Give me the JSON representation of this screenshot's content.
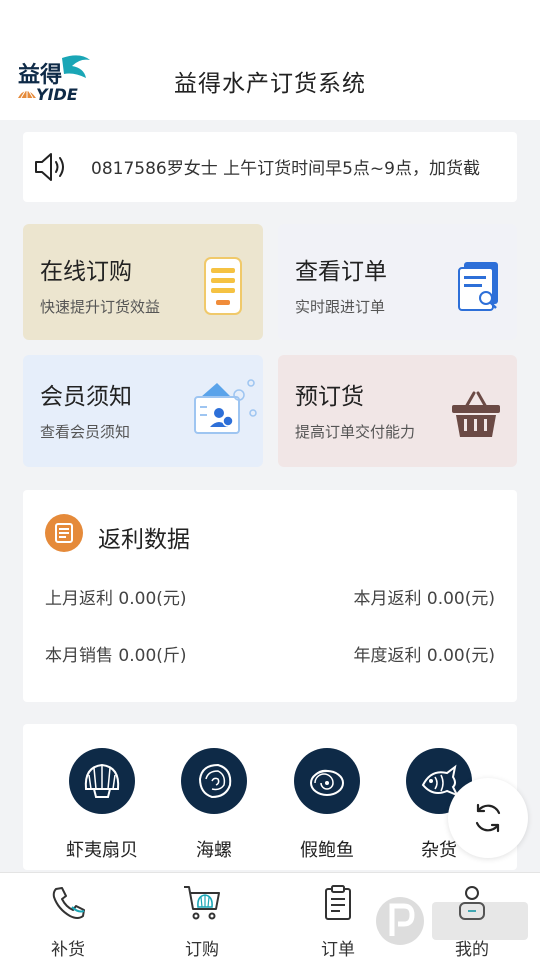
{
  "header": {
    "title": "益得水产订货系统",
    "logo_text": "益得YIDE"
  },
  "notice": {
    "text": "0817586罗女士   上午订货时间早5点~9点，加货截"
  },
  "cards": [
    {
      "title": "在线订购",
      "subtitle": "快速提升订货效益",
      "icon": "phone-list-icon"
    },
    {
      "title": "查看订单",
      "subtitle": "实时跟进订单",
      "icon": "document-search-icon"
    },
    {
      "title": "会员须知",
      "subtitle": "查看会员须知",
      "icon": "member-card-icon"
    },
    {
      "title": "预订货",
      "subtitle": "提高订单交付能力",
      "icon": "basket-icon"
    }
  ],
  "rebate": {
    "title": "返利数据",
    "last_month": "上月返利 0.00(元)",
    "this_month": "本月返利 0.00(元)",
    "this_month_sales": "本月销售 0.00(斤)",
    "annual": "年度返利  0.00(元)"
  },
  "categories": [
    {
      "label": "虾夷扇贝",
      "icon": "scallop-icon"
    },
    {
      "label": "海螺",
      "icon": "conch-icon"
    },
    {
      "label": "假鲍鱼",
      "icon": "abalone-icon"
    },
    {
      "label": "杂货",
      "icon": "fish-icon"
    }
  ],
  "tabbar": [
    {
      "label": "补货",
      "icon": "phone-icon"
    },
    {
      "label": "订购",
      "icon": "cart-icon"
    },
    {
      "label": "订单",
      "icon": "clipboard-icon"
    },
    {
      "label": "我的",
      "icon": "user-icon"
    }
  ],
  "colors": {
    "navy": "#0e2a47",
    "accent_orange": "#e58a3a",
    "card_online": "#ece5cf",
    "card_orders": "#f1f2f7",
    "card_member": "#e6eefa",
    "card_preorder": "#f1e6e6"
  }
}
